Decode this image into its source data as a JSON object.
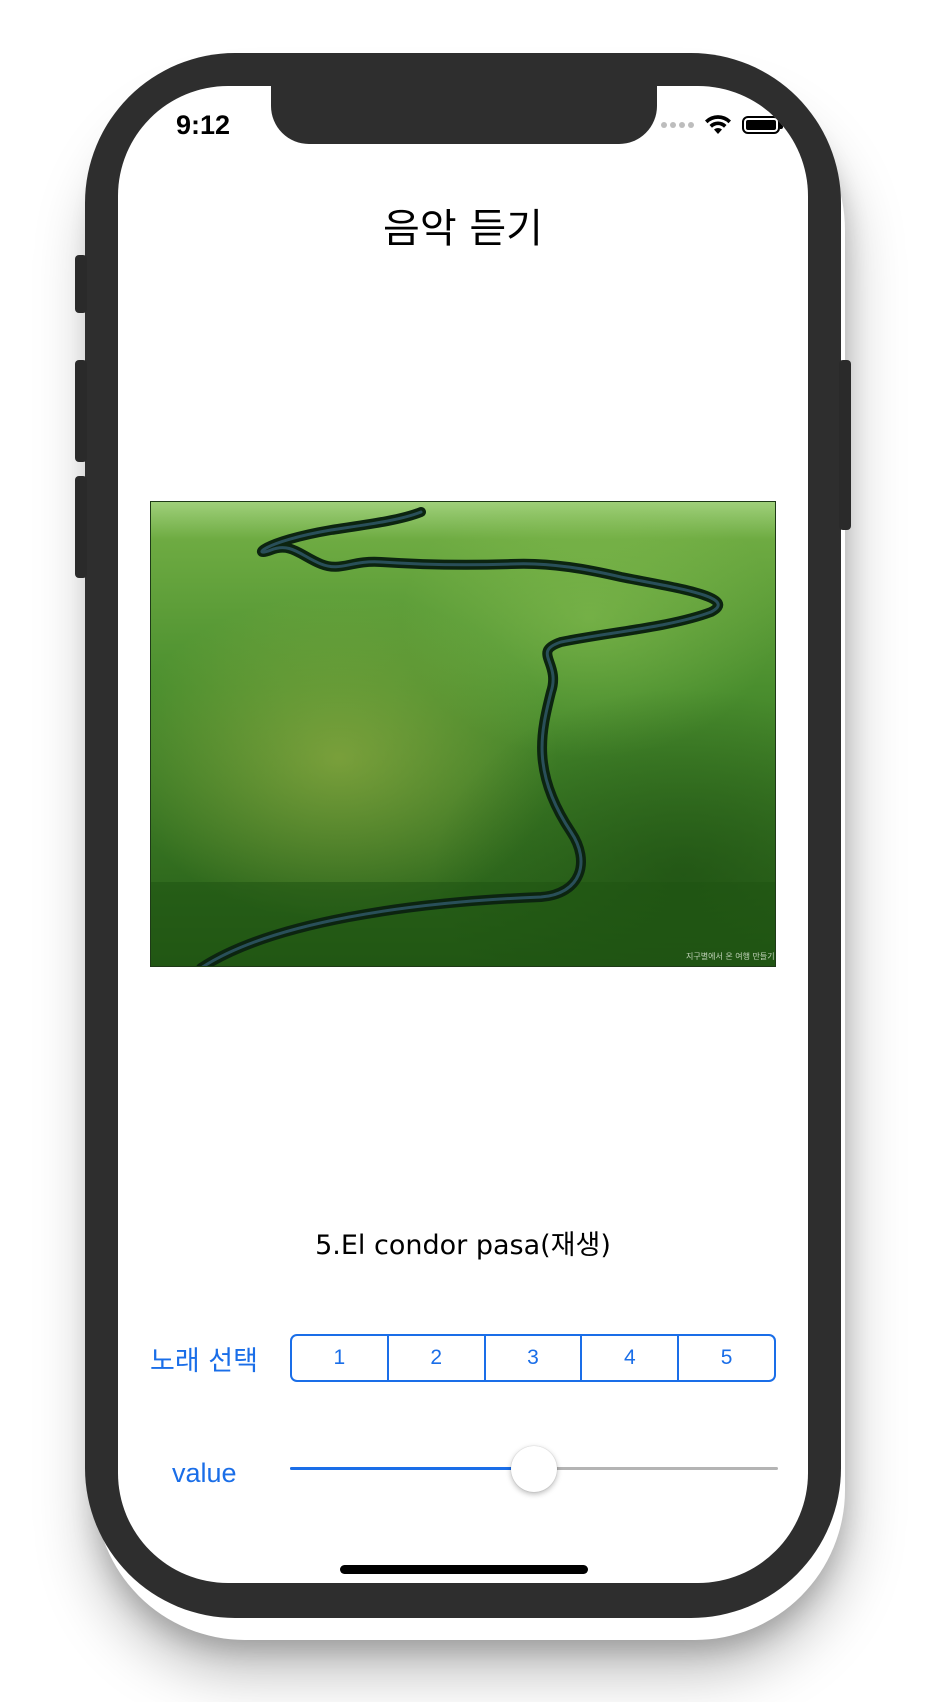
{
  "status_bar": {
    "time": "9:12",
    "signal_icon": "cellular-signal-icon",
    "wifi_icon": "wifi-icon",
    "battery_icon": "battery-icon"
  },
  "header": {
    "title": "음악 듣기"
  },
  "album_art": {
    "description_icon": "river-landscape-image",
    "watermark": "지구별에서 온 여행 만들기"
  },
  "now_playing": {
    "song_title": "5.El condor pasa(재생)"
  },
  "song_select": {
    "label": "노래 선택",
    "segments": [
      "1",
      "2",
      "3",
      "4",
      "5"
    ]
  },
  "volume": {
    "label": "value",
    "level": 0.5
  },
  "colors": {
    "accent": "#1a6ee8",
    "device": "#2e2e2e",
    "grass": "#3a7a28"
  }
}
